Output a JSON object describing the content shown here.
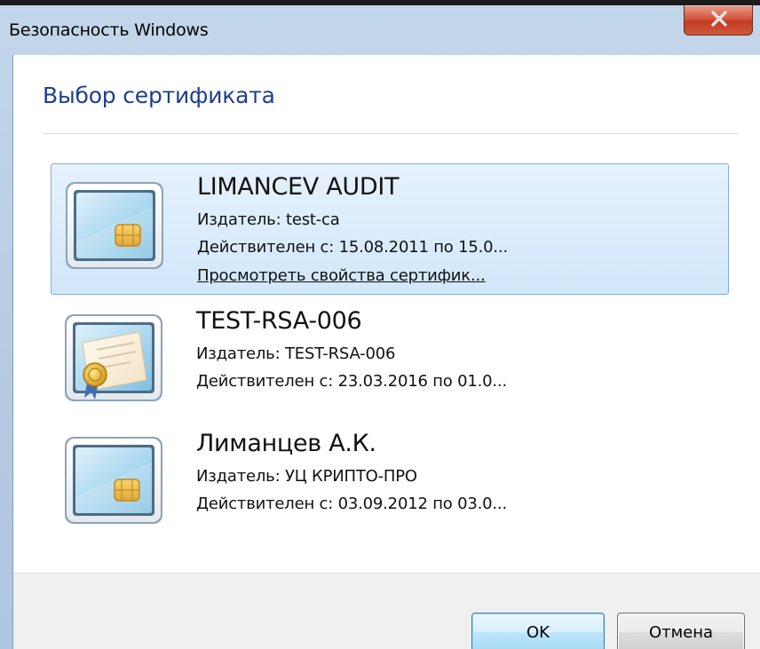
{
  "window": {
    "title": "Безопасность Windows",
    "close_glyph": "x"
  },
  "dialog": {
    "heading": "Выбор сертификата"
  },
  "certificates": [
    {
      "name": "LIMANCEV AUDIT",
      "issuer": "Издатель: test-ca",
      "validity": "Действителен с: 15.08.2011 по 15.0...",
      "link": "Просмотреть свойства сертифик...",
      "icon": "smartcard-icon",
      "selected": true
    },
    {
      "name": "TEST-RSA-006",
      "issuer": "Издатель: TEST-RSA-006",
      "validity": "Действителен с: 23.03.2016 по 01.0...",
      "icon": "certificate-seal-icon",
      "selected": false
    },
    {
      "name": "Лиманцев А.К.",
      "issuer": "Издатель: УЦ КРИПТО-ПРО",
      "validity": "Действителен с: 03.09.2012 по 03.0...",
      "icon": "smartcard-icon",
      "selected": false
    }
  ],
  "buttons": {
    "ok": "OK",
    "cancel": "Отмена"
  },
  "colors": {
    "heading": "#1e3d8f",
    "selection_bg": "#d2e7fa",
    "selection_border": "#84acdd",
    "close_button": "#c23b22"
  }
}
